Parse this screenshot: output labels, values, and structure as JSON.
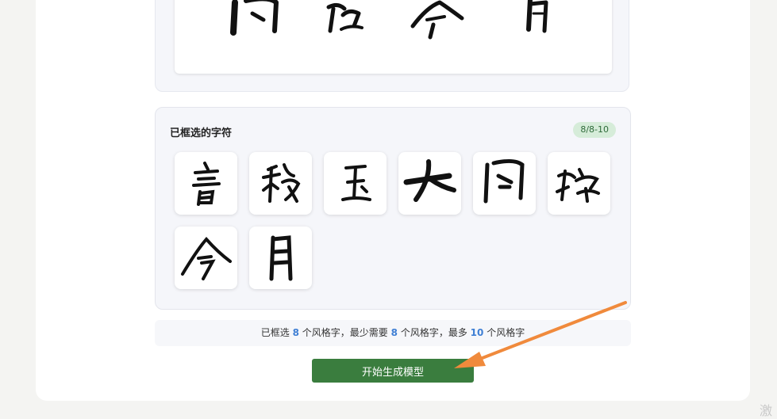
{
  "selected_panel": {
    "title": "已框选的字符",
    "badge": "8/8-10",
    "tiles": [
      {
        "char": "音"
      },
      {
        "char": "秋"
      },
      {
        "char": "玉"
      },
      {
        "char": "大"
      },
      {
        "char": "问"
      },
      {
        "char": "核"
      },
      {
        "char": "今"
      },
      {
        "char": "月"
      }
    ]
  },
  "info": {
    "prefix": "已框选",
    "selected_count": "8",
    "mid1": "个风格字，最少需要",
    "min_count": "8",
    "mid2": "个风格字，最多",
    "max_count": "10",
    "suffix": "个风格字"
  },
  "start_button": {
    "label": "开始生成模型"
  },
  "colors": {
    "button": "#3a7d3e",
    "badge_bg": "#d6ecd9",
    "number_accent": "#3f7fd4",
    "annotation_arrow": "#f08a3c"
  },
  "watermark": {
    "text": "激"
  }
}
